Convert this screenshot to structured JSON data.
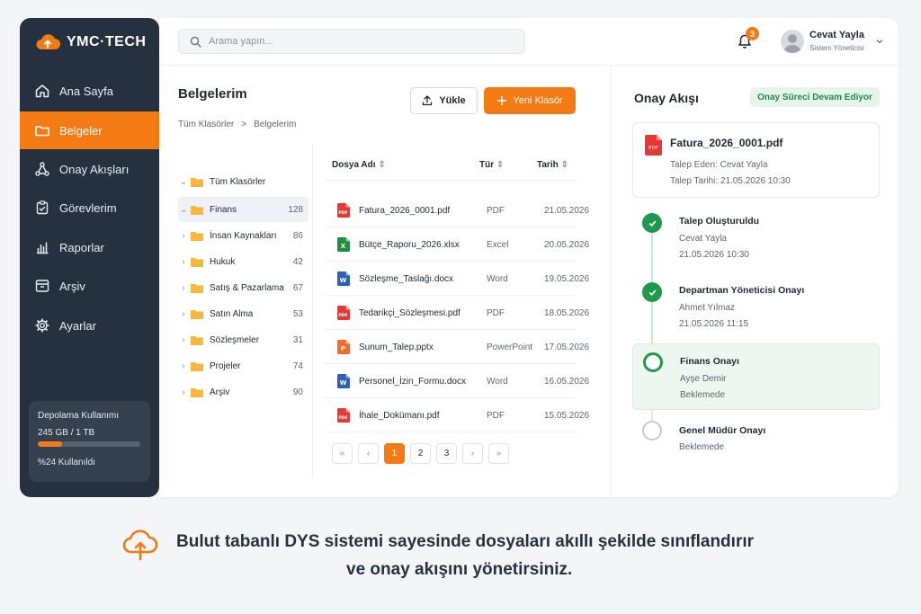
{
  "brand": {
    "name": "YMC·TECH"
  },
  "sidebar": {
    "items": [
      {
        "label": "Ana Sayfa",
        "icon": "home-icon"
      },
      {
        "label": "Belgeler",
        "icon": "folder-icon",
        "active": true
      },
      {
        "label": "Onay Akışları",
        "icon": "workflow-icon"
      },
      {
        "label": "Görevlerim",
        "icon": "clipboard-check-icon"
      },
      {
        "label": "Raporlar",
        "icon": "bar-chart-icon"
      },
      {
        "label": "Arşiv",
        "icon": "archive-icon"
      },
      {
        "label": "Ayarlar",
        "icon": "gear-icon"
      }
    ],
    "storage": {
      "title": "Depolama Kullanımı",
      "value": "245 GB / 1 TB",
      "percent": 24,
      "used_label": "%24 Kullanıldı"
    }
  },
  "header": {
    "search_placeholder": "Arama yapın...",
    "notification_count": "3",
    "user_name": "Cevat Yayla",
    "user_role": "Sistem Yöneticisi"
  },
  "docs": {
    "title": "Belgelerim",
    "breadcrumb": [
      "Tüm Klasörler",
      ">",
      "Belgelerim"
    ],
    "upload_label": "Yükle",
    "new_folder_label": "Yeni Klasör",
    "tree_root": "Tüm Klasörler",
    "folders": [
      {
        "name": "Finans",
        "count": "128",
        "selected": true
      },
      {
        "name": "İnsan Kaynakları",
        "count": "86"
      },
      {
        "name": "Hukuk",
        "count": "42"
      },
      {
        "name": "Satış & Pazarlama",
        "count": "67"
      },
      {
        "name": "Satın Alma",
        "count": "53"
      },
      {
        "name": "Sözleşmeler",
        "count": "31"
      },
      {
        "name": "Projeler",
        "count": "74"
      },
      {
        "name": "Arşiv",
        "count": "90"
      }
    ],
    "columns": {
      "name": "Dosya Adı",
      "type": "Tür",
      "date": "Tarih"
    },
    "files": [
      {
        "name": "Fatura_2026_0001.pdf",
        "type": "PDF",
        "date": "21.05.2026",
        "kind": "pdf"
      },
      {
        "name": "Bütçe_Raporu_2026.xlsx",
        "type": "Excel",
        "date": "20.05.2026",
        "kind": "excel"
      },
      {
        "name": "Sözleşme_Taslağı.docx",
        "type": "Word",
        "date": "19.05.2026",
        "kind": "word"
      },
      {
        "name": "Tedarikçi_Sözleşmesi.pdf",
        "type": "PDF",
        "date": "18.05.2026",
        "kind": "pdf"
      },
      {
        "name": "Sunum_Talep.pptx",
        "type": "PowerPoint",
        "date": "17.05.2026",
        "kind": "ppt"
      },
      {
        "name": "Personel_İzin_Formu.docx",
        "type": "Word",
        "date": "16.05.2026",
        "kind": "word"
      },
      {
        "name": "İhale_Dokümanı.pdf",
        "type": "PDF",
        "date": "15.05.2026",
        "kind": "pdf"
      }
    ],
    "pager": {
      "first": "«",
      "prev": "‹",
      "pages": [
        "1",
        "2",
        "3"
      ],
      "next": "›",
      "last": "»"
    }
  },
  "flow": {
    "title": "Onay Akışı",
    "status": "Onay Süreci Devam Ediyor",
    "file": {
      "name": "Fatura_2026_0001.pdf",
      "requested_by": "Talep Eden: Cevat Yayla",
      "requested_at": "Talep Tarihi: 21.05.2026 10:30"
    },
    "steps": [
      {
        "title": "Talep Oluşturuldu",
        "line1": "Cevat Yayla",
        "line2": "21.05.2026 10:30",
        "state": "done"
      },
      {
        "title": "Departman Yöneticisi Onayı",
        "line1": "Ahmet Yılmaz",
        "line2": "21.05.2026 11:15",
        "state": "done"
      },
      {
        "title": "Finans Onayı",
        "line1": "Ayşe Demir",
        "line2": "Beklemede",
        "state": "current"
      },
      {
        "title": "Genel Müdür Onayı",
        "line1": "Beklemede",
        "line2": "",
        "state": "pending"
      }
    ]
  },
  "caption": {
    "line1": "Bulut tabanlı DYS sistemi sayesinde dosyaları akıllı şekilde sınıflandırır",
    "line2": "ve onay akışını yönetirsiniz."
  },
  "colors": {
    "accent": "#f47a14",
    "sidebar": "#263140",
    "success": "#1f9a4a"
  }
}
